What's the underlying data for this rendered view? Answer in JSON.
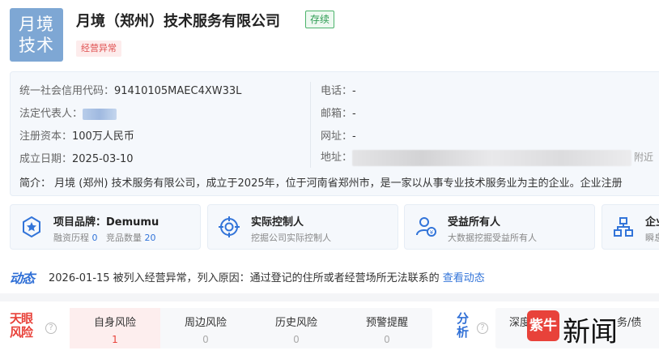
{
  "header": {
    "logo_line1": "月境",
    "logo_line2": "技术",
    "company_name": "月境（郑州）技术服务有限公司",
    "status_tag": "存续",
    "abnormal_tag": "经营异常"
  },
  "info": {
    "credit_code_label": "统一社会信用代码：",
    "credit_code": "91410105MAEC4XW33L",
    "legal_rep_label": "法定代表人：",
    "capital_label": "注册资本：",
    "capital": "100万人民币",
    "founded_label": "成立日期：",
    "founded": "2025-03-10",
    "phone_label": "电话：",
    "phone": "-",
    "email_label": "邮箱：",
    "email": "-",
    "website_label": "网址：",
    "website": "-",
    "address_label": "地址：",
    "address_suffix": "附近",
    "intro": "简介：  月境 (郑州) 技术服务有限公司，成立于2025年，位于河南省郑州市，是一家以从事专业技术服务业为主的企业。企业注册"
  },
  "features": [
    {
      "title": "项目品牌：Demumu",
      "sub_a": "融资历程",
      "sub_a_num": "0",
      "sub_b": "竞品数量",
      "sub_b_num": "20"
    },
    {
      "title": "实际控制人",
      "sub": "挖掘公司实际控制人"
    },
    {
      "title": "受益所有人",
      "sub": "大数据挖掘受益所有人"
    },
    {
      "title": "企业",
      "sub": "瞬息"
    }
  ],
  "dynamic": {
    "logo": "动态",
    "text": "2026-01-15 被列入经营异常，列入原因：通过登记的住所或者经营场所无法联系的",
    "link": "查看动态"
  },
  "risk": {
    "logo_line1": "天眼",
    "logo_line2": "风险",
    "tabs": [
      {
        "label": "自身风险",
        "value": "1"
      },
      {
        "label": "周边风险",
        "value": "0"
      },
      {
        "label": "历史风险",
        "value": "0"
      },
      {
        "label": "预警提醒",
        "value": "0"
      }
    ]
  },
  "analysis": {
    "logo_line1": "分",
    "logo_line2": "析",
    "item1": "深度",
    "item2": "务/债"
  },
  "watermark": {
    "badge": "紫牛",
    "text": "新闻"
  },
  "colors": {
    "accent_blue": "#3274d9",
    "risk_red": "#e8423a",
    "status_green": "#2d9b52"
  }
}
